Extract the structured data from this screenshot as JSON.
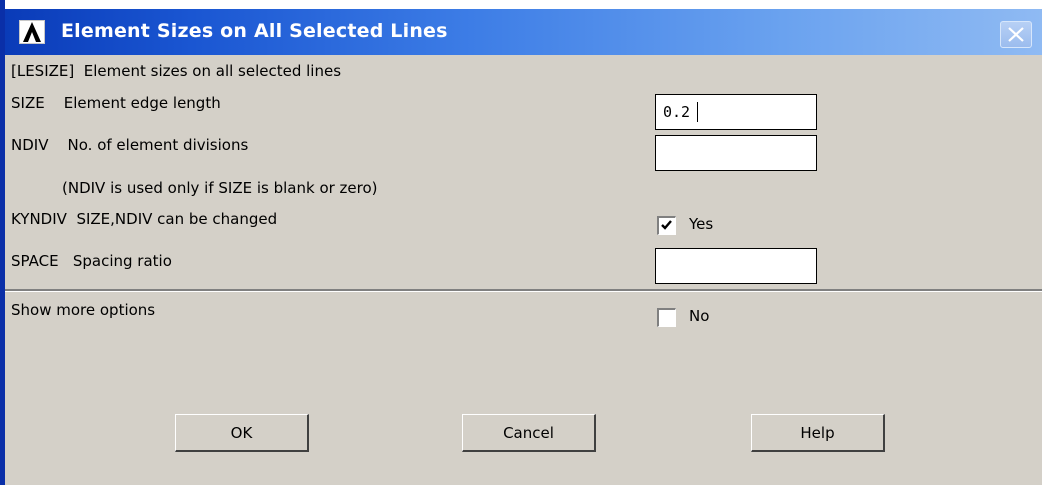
{
  "window": {
    "title": "Element Sizes on All Selected Lines"
  },
  "header": {
    "description": "[LESIZE]  Element sizes on all selected lines"
  },
  "fields": {
    "size": {
      "label": "SIZE    Element edge length",
      "value": "0.2"
    },
    "ndiv": {
      "label": "NDIV    No. of element divisions",
      "value": ""
    },
    "ndiv_note": "(NDIV is used only if SIZE is blank or zero)",
    "kyndiv": {
      "label": "KYNDIV  SIZE,NDIV can be changed",
      "checked": true,
      "option_text": "Yes"
    },
    "space": {
      "label": "SPACE   Spacing ratio",
      "value": ""
    }
  },
  "more_options": {
    "label": "Show more options",
    "checked": false,
    "option_text": "No"
  },
  "buttons": {
    "ok": "OK",
    "cancel": "Cancel",
    "help": "Help"
  },
  "icons": {
    "app": "ansys-logo-icon",
    "close": "close-icon",
    "check": "checkmark-icon"
  },
  "colors": {
    "titlebar_start": "#0a3bb8",
    "titlebar_end": "#8fbaf3",
    "dialog_background": "#d4d0c8"
  }
}
